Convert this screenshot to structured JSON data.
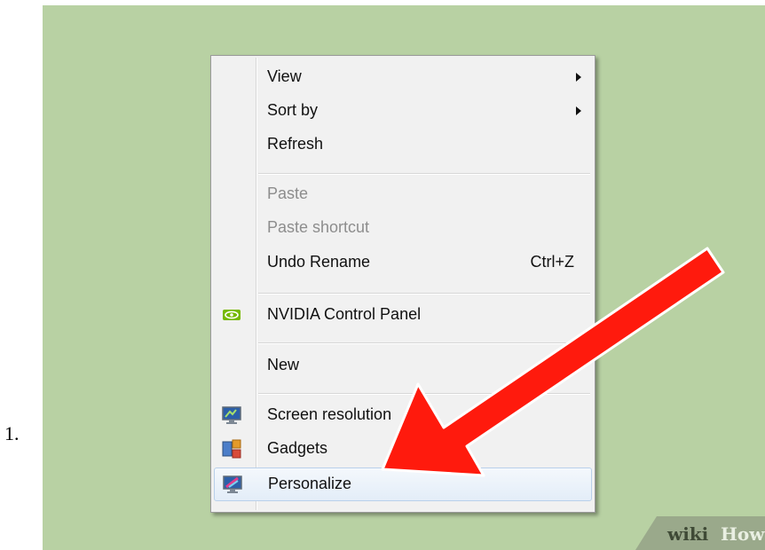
{
  "step": {
    "number": "1."
  },
  "menu": {
    "items": [
      {
        "label": "View",
        "submenu": true,
        "disabled": false
      },
      {
        "label": "Sort by",
        "submenu": true,
        "disabled": false
      },
      {
        "label": "Refresh",
        "disabled": false
      },
      {
        "label": "Paste",
        "disabled": true
      },
      {
        "label": "Paste shortcut",
        "disabled": true
      },
      {
        "label": "Undo Rename",
        "shortcut": "Ctrl+Z",
        "disabled": false
      },
      {
        "label": "NVIDIA Control Panel",
        "icon": "nvidia-icon",
        "disabled": false
      },
      {
        "label": "New",
        "submenu": true,
        "disabled": false
      },
      {
        "label": "Screen resolution",
        "icon": "monitor-icon",
        "disabled": false
      },
      {
        "label": "Gadgets",
        "icon": "gadgets-icon",
        "disabled": false
      },
      {
        "label": "Personalize",
        "icon": "personalize-icon",
        "highlighted": true,
        "disabled": false
      }
    ]
  },
  "annotation": {
    "arrow_color": "#ff1a0d",
    "arrow_icon": "red-arrow-pointer"
  },
  "watermark": {
    "part1": "wiki",
    "part2": "How"
  },
  "colors": {
    "desktop": "#b8d1a3",
    "menu": "#f1f1f1",
    "highlight": "#e3edf8"
  }
}
